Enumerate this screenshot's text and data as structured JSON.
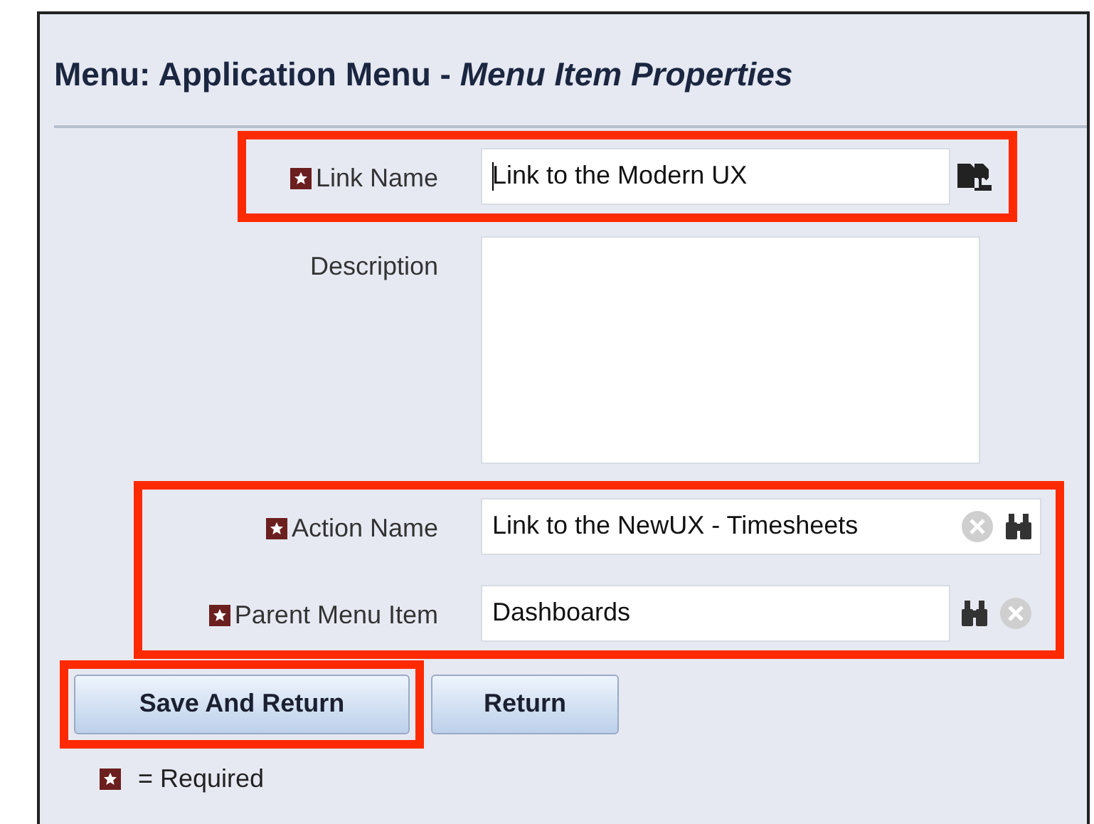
{
  "title": {
    "prefix": "Menu: Application Menu - ",
    "emphasis": "Menu Item Properties"
  },
  "sections": [
    {
      "highlighted": true,
      "fields": [
        {
          "kind": "translatable",
          "label": "Link Name",
          "required": true,
          "value": "Link to the Modern UX",
          "focused": true
        }
      ]
    },
    {
      "highlighted": false,
      "fields": [
        {
          "kind": "textarea",
          "label": "Description",
          "required": false
        }
      ]
    },
    {
      "highlighted": true,
      "fields": [
        {
          "kind": "lookup",
          "label": "Action Name",
          "required": true,
          "value": "Link to the NewUX - Timesheets",
          "focused": false
        },
        {
          "kind": "lookup_outside",
          "label": "Parent Menu Item",
          "required": true,
          "value": "Dashboards",
          "focused": false
        }
      ]
    }
  ],
  "buttons": [
    {
      "label": "Save And Return",
      "highlighted": true
    },
    {
      "label": "Return",
      "highlighted": false
    }
  ],
  "legend": "= Required"
}
